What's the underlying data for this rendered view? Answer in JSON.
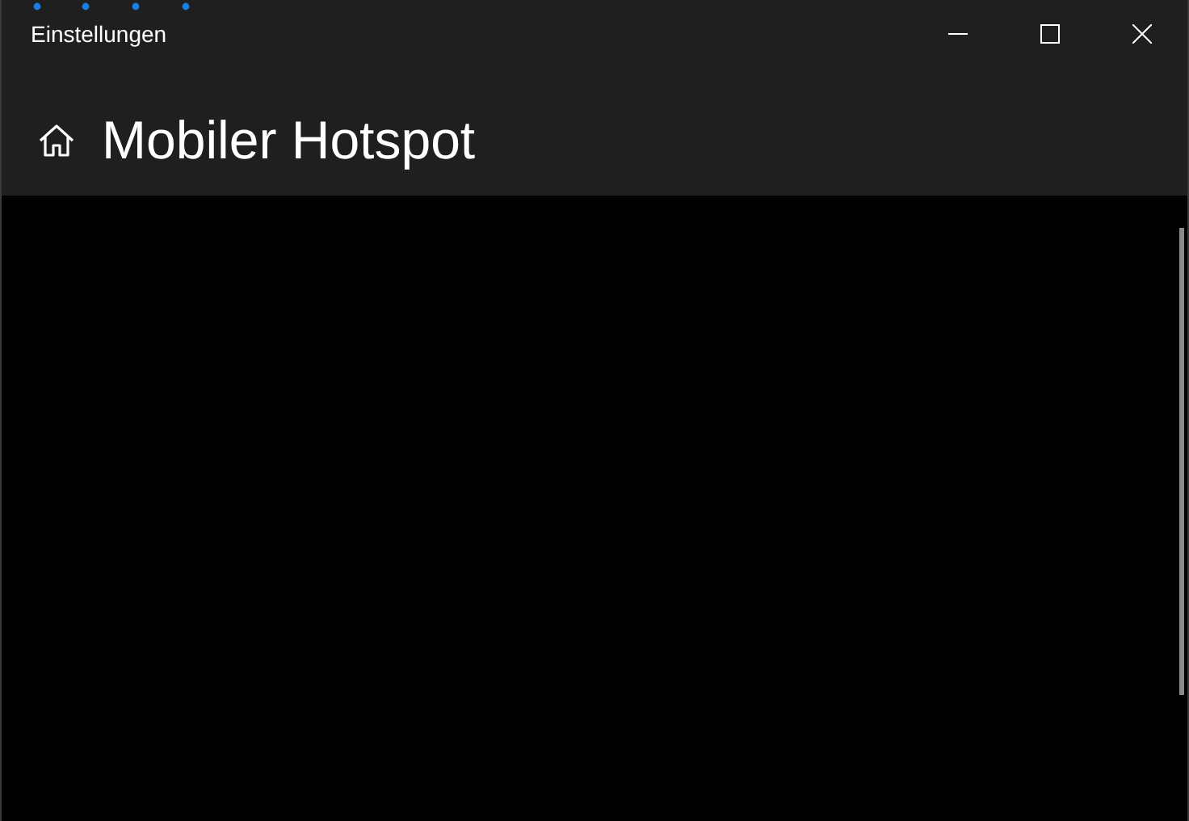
{
  "window": {
    "title": "Einstellungen"
  },
  "header": {
    "title": "Mobiler Hotspot"
  }
}
